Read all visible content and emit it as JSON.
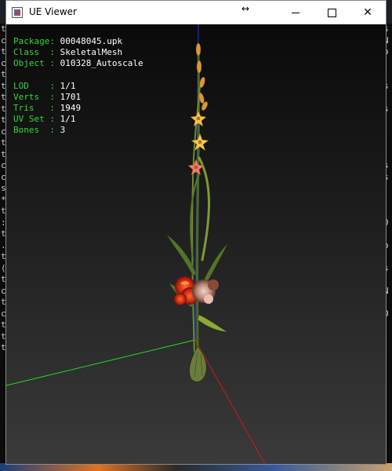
{
  "window": {
    "title": "UE Viewer",
    "resize_glyph": "↔",
    "minimize_icon": "minimize-icon",
    "maximize_icon": "maximize-icon",
    "close_glyph": "✕"
  },
  "info": {
    "package_key": "Package:",
    "package_value": "00048045.upk",
    "class_key": "Class  :",
    "class_value": "SkeletalMesh",
    "object_key": "Object :",
    "object_value": "010328_Autoscale",
    "lod_key": "LOD    :",
    "lod_value": "1/1",
    "verts_key": "Verts  :",
    "verts_value": "1701",
    "tris_key": "Tris   :",
    "tris_value": "1949",
    "uvset_key": "UV Set :",
    "uvset_value": "1/1",
    "bones_key": "Bones  :",
    "bones_value": "3"
  },
  "background_console": {
    "left_chars": [
      "t",
      "c",
      "t",
      "c",
      "t",
      "t",
      "t",
      "t",
      "t",
      "c",
      "t",
      "t",
      "c",
      "c",
      "s",
      "*",
      "t",
      ":",
      "t",
      ".",
      "t",
      "(",
      "t",
      "c",
      "t",
      "c",
      "t",
      "t",
      "t"
    ],
    "right_chars": [
      "s",
      "N",
      "o",
      "",
      "",
      "s",
      "",
      "s",
      "",
      "",
      "",
      "",
      "s",
      "s",
      "",
      "",
      "",
      "0",
      "",
      "o",
      "",
      "s",
      "",
      "N",
      "",
      "O"
    ]
  },
  "colors": {
    "label": "#36d636",
    "value": "#ffffff",
    "axis_x": "#cc1a1a",
    "axis_y": "#22dd22",
    "axis_z": "#2233ff"
  }
}
